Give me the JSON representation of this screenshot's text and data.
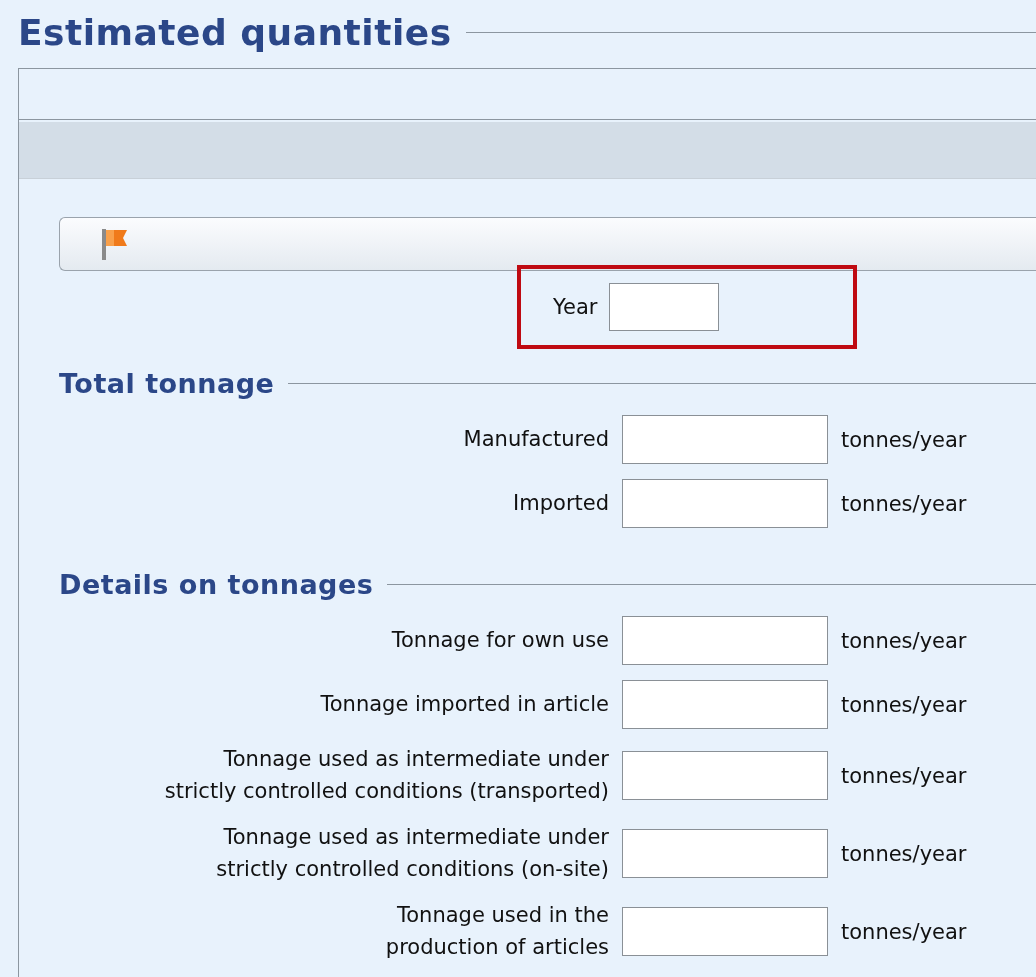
{
  "title": "Estimated quantities",
  "year": {
    "label": "Year",
    "highlighted": true
  },
  "sections": [
    {
      "heading": "Total tonnage",
      "rows": [
        {
          "lines": [
            "Manufactured"
          ],
          "unit": "tonnes/year"
        },
        {
          "lines": [
            "Imported"
          ],
          "unit": "tonnes/year"
        }
      ]
    },
    {
      "heading": "Details on tonnages",
      "rows": [
        {
          "lines": [
            "Tonnage for own use"
          ],
          "unit": "tonnes/year"
        },
        {
          "lines": [
            "Tonnage imported in article"
          ],
          "unit": "tonnes/year"
        },
        {
          "lines": [
            "Tonnage used as intermediate under",
            "strictly controlled conditions (transported)"
          ],
          "unit": "tonnes/year"
        },
        {
          "lines": [
            "Tonnage used as intermediate under",
            "strictly controlled conditions (on-site)"
          ],
          "unit": "tonnes/year"
        },
        {
          "lines": [
            "Tonnage used in the",
            "production of articles"
          ],
          "unit": "tonnes/year"
        }
      ]
    }
  ]
}
